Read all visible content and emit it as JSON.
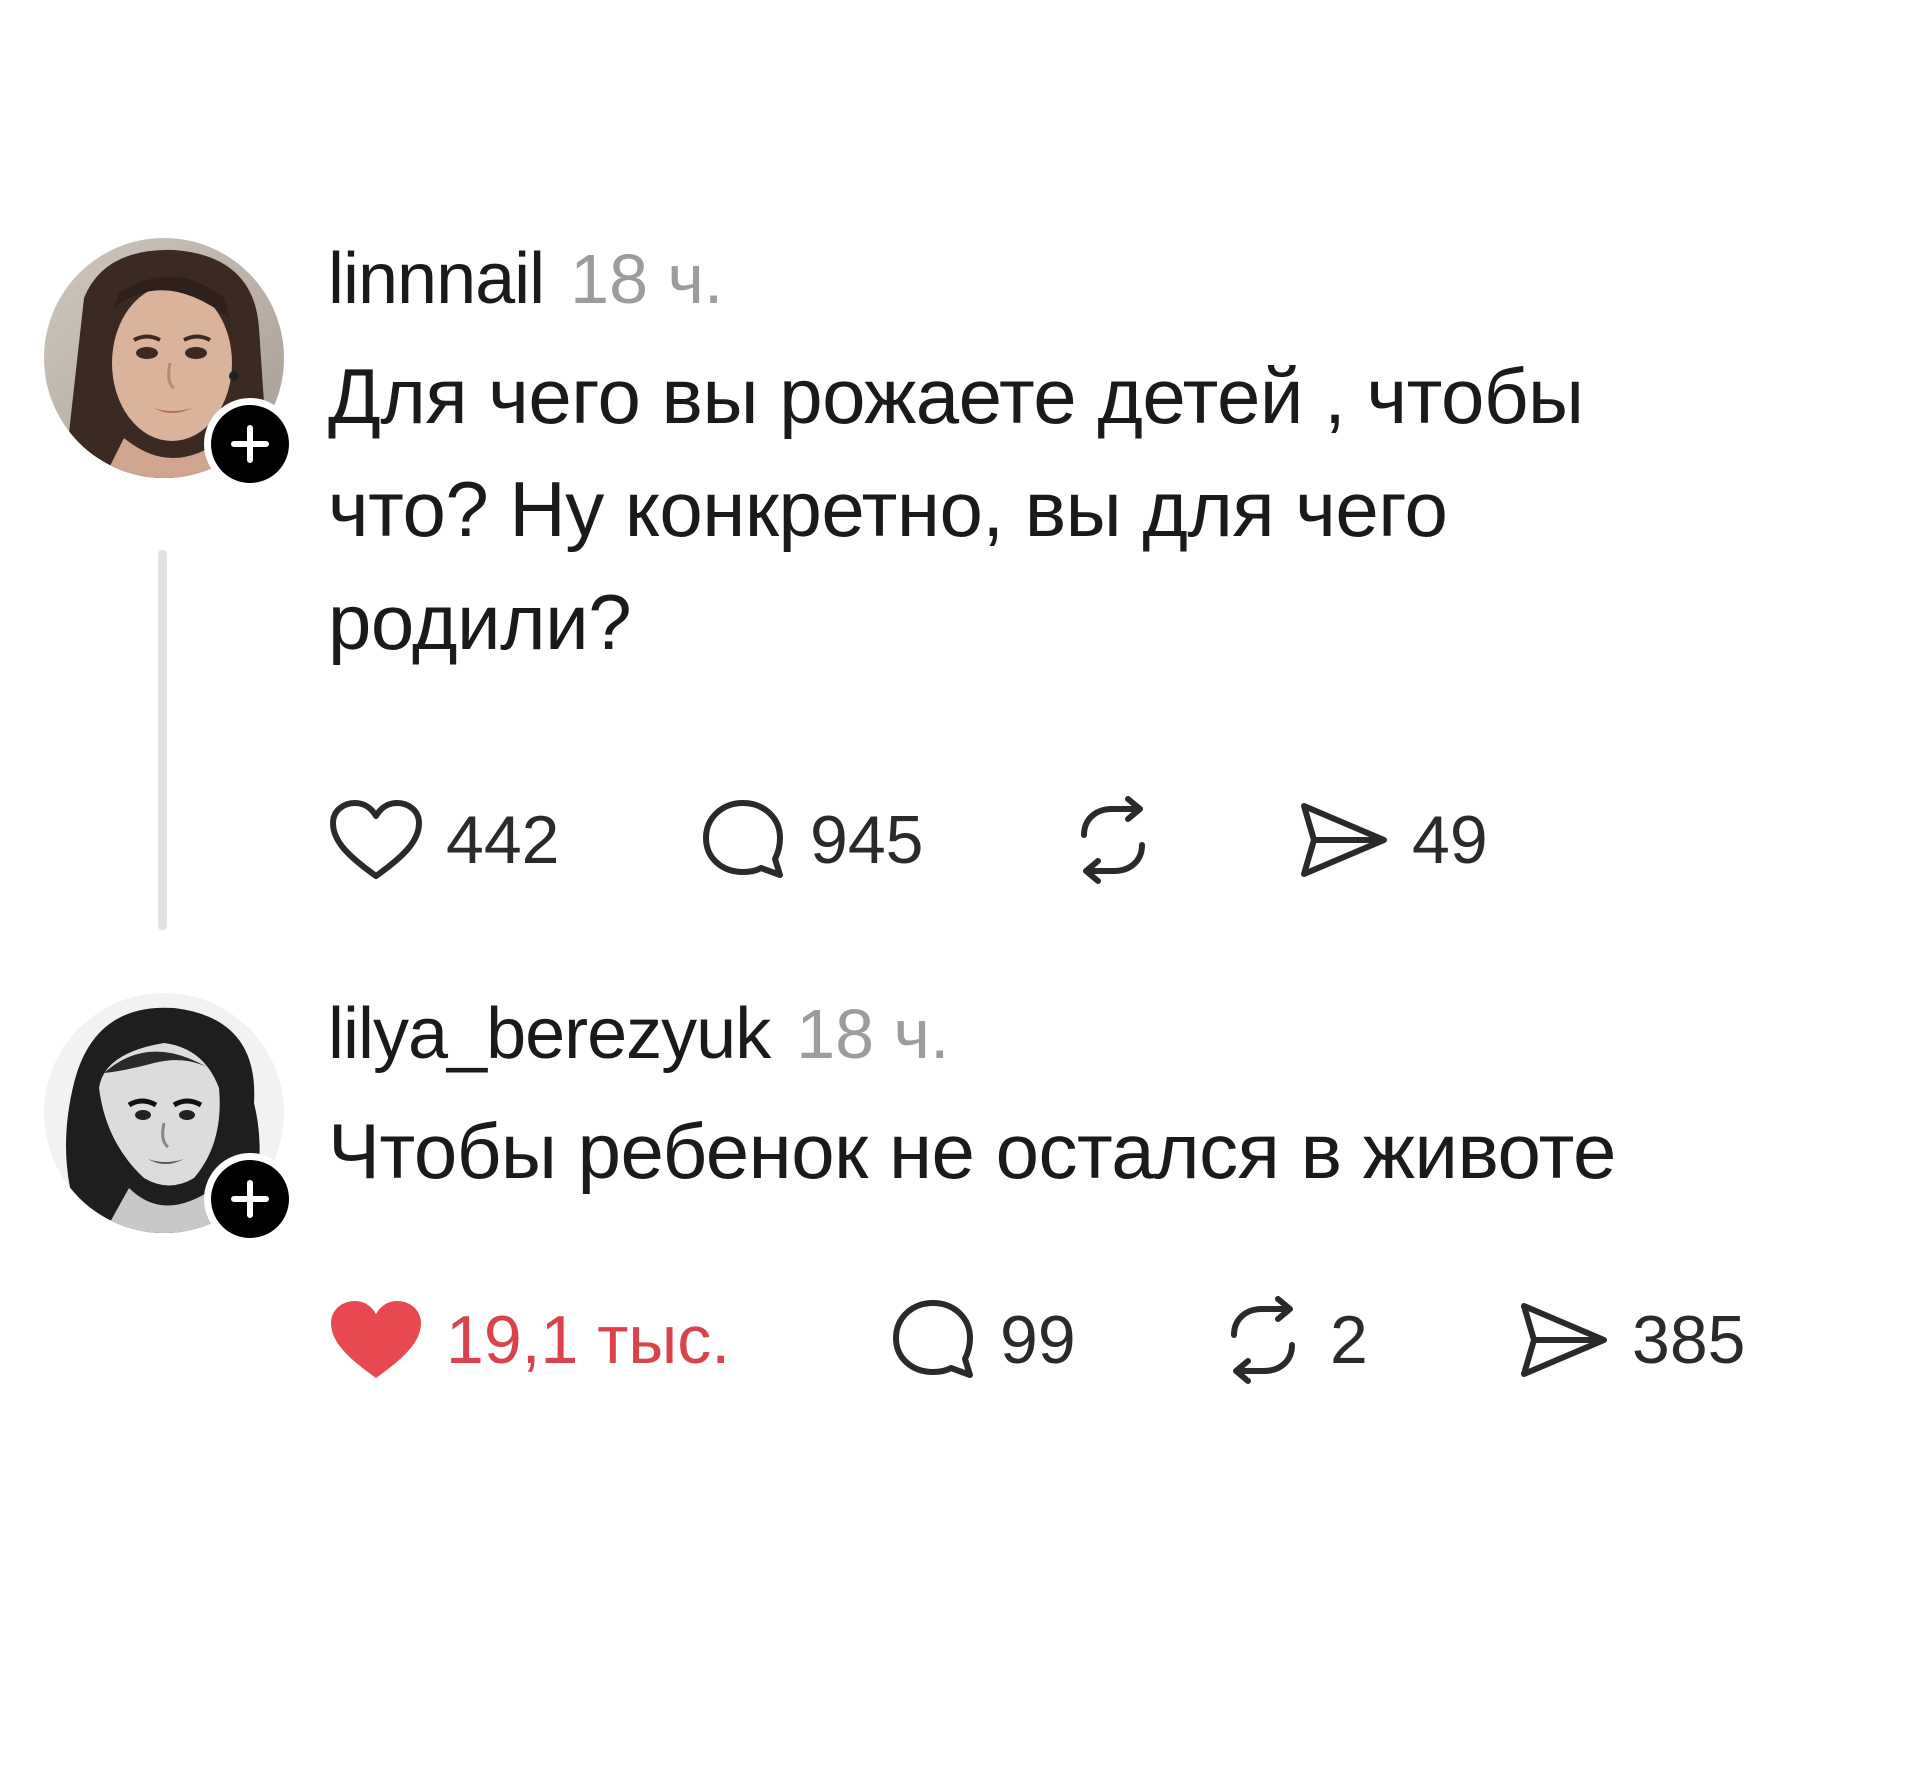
{
  "posts": [
    {
      "username": "linnnail",
      "time": "18 ч.",
      "text_lines": [
        "Для чего вы рожаете детей , чтобы",
        "что? Ну конкретно, вы для чего",
        "родили?"
      ],
      "actions": {
        "likes": "442",
        "comments": "945",
        "reposts": "",
        "shares": "49"
      },
      "liked": false,
      "avatar_icon": "avatar-photo-woman",
      "follow_icon": "plus-icon"
    },
    {
      "username": "lilya_berezyuk",
      "time": "18 ч.",
      "text_lines": [
        "Чтобы ребенок не остался в животе"
      ],
      "actions": {
        "likes": "19,1 тыс.",
        "comments": "99",
        "reposts": "2",
        "shares": "385"
      },
      "liked": true,
      "avatar_icon": "avatar-illustration-woman",
      "follow_icon": "plus-icon"
    }
  ],
  "colors": {
    "like_active": "#e8484f",
    "like_active_text": "#d9434c",
    "text": "#1a1a1a",
    "muted": "#9c9c9c",
    "thread_line": "#e3e3e3",
    "badge": "#000000"
  }
}
